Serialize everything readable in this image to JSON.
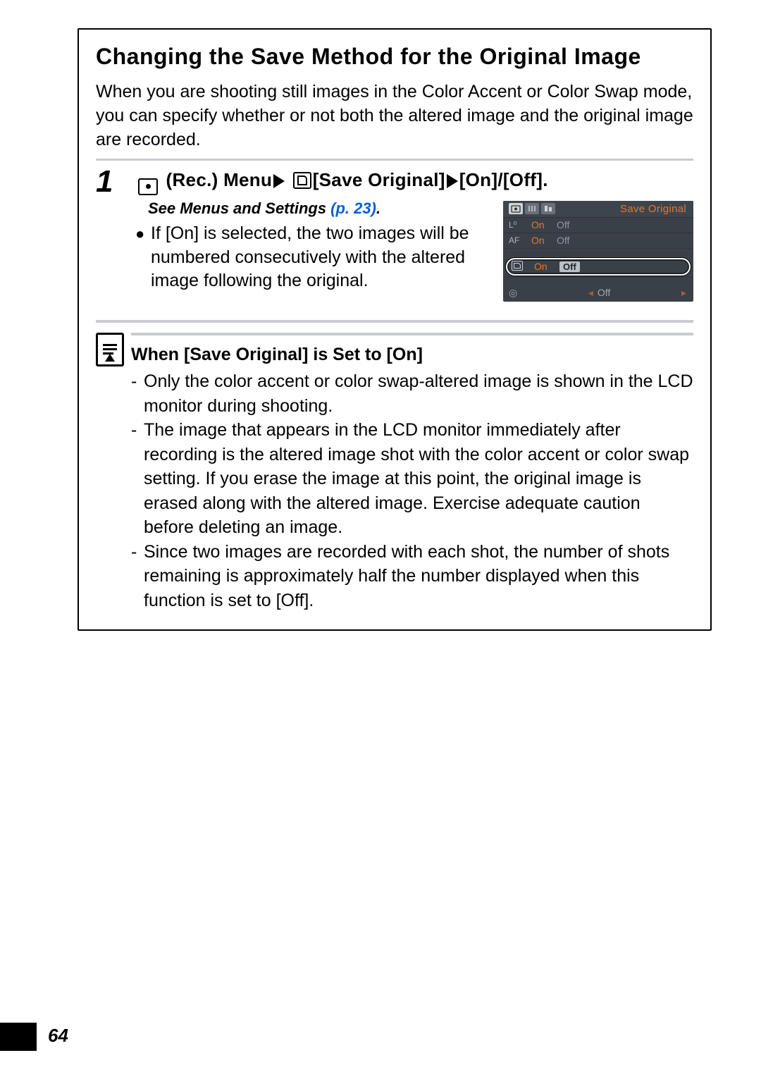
{
  "section_title": "Changing the Save Method for the Original Image",
  "intro": "When you are shooting still images in the Color Accent or Color Swap mode, you can specify whether or not both the altered image and the original image are recorded.",
  "step": {
    "number": "1",
    "heading_parts": {
      "rec_menu": " (Rec.) Menu",
      "save_original": "[Save Original]",
      "on_off": "[On]/[Off]."
    },
    "see_ref_prefix": "See Menus and Settings ",
    "see_ref_link": "(p. 23)",
    "see_ref_suffix": ".",
    "bullet": "If [On] is selected, the two images will be numbered consecutively with the altered image following the original."
  },
  "lcd": {
    "title": "Save Original",
    "rows": [
      {
        "icon": "L⁰",
        "on": "On",
        "off": "Off"
      },
      {
        "icon": "AF",
        "on": "On",
        "off": "Off"
      }
    ],
    "selected": {
      "on": "On",
      "off": "Off"
    },
    "bottom_off": "Off"
  },
  "note": {
    "title": "When [Save Original] is Set to [On]",
    "items": [
      "Only the color accent or color swap-altered image is shown in the LCD monitor during shooting.",
      "The image that appears in the LCD monitor immediately after recording is the altered image shot with the color accent or color swap setting. If you erase the image at this point, the original image is erased along with the altered image. Exercise adequate caution before deleting an image.",
      "Since two images are recorded with each shot, the number of shots remaining is approximately half the number displayed when this function is set to [Off]."
    ]
  },
  "page_number": "64"
}
